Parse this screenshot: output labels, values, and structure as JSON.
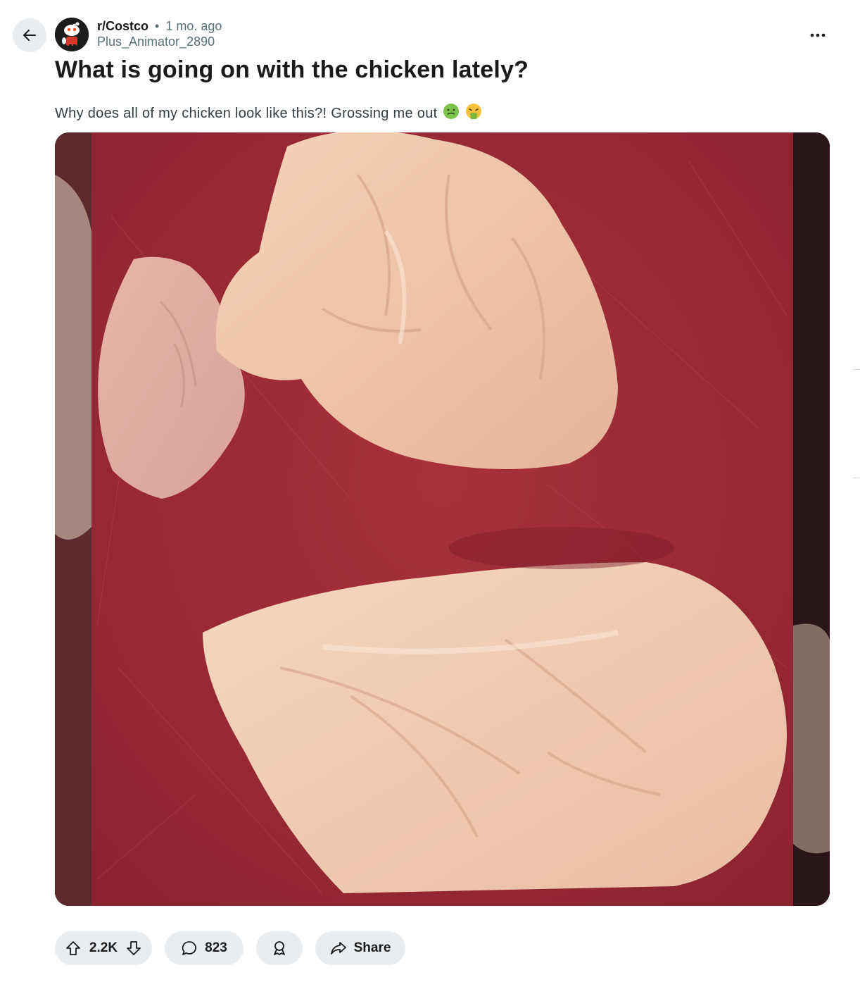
{
  "post": {
    "subreddit": "r/Costco",
    "separator": "•",
    "time": "1 mo. ago",
    "author": "Plus_Animator_2890",
    "title": "What is going on with the chicken lately?",
    "body": "Why does all of my chicken look like this?! Grossing me out",
    "emojis": [
      "nauseated-face",
      "vomiting-face"
    ]
  },
  "actions": {
    "vote_count": "2.2K",
    "comment_count": "823",
    "share_label": "Share"
  },
  "icons": {
    "back": "arrow-left-icon",
    "more": "ellipsis-icon",
    "upvote": "upvote-arrow-icon",
    "downvote": "downvote-arrow-icon",
    "comment": "speech-bubble-icon",
    "award": "award-icon",
    "share": "share-arrow-icon"
  },
  "colors": {
    "pill_bg": "#eaedef",
    "text_primary": "#1a1a1b",
    "text_meta": "#576f76"
  }
}
